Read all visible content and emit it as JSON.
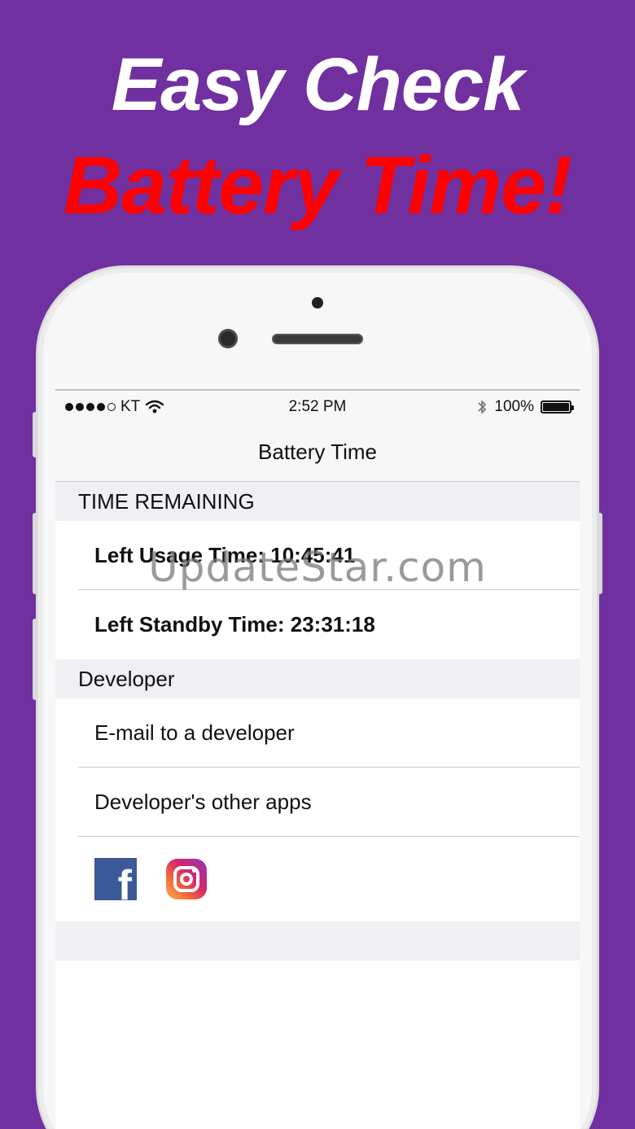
{
  "promo": {
    "line1": "Easy Check",
    "line2": "Battery Time!"
  },
  "colors": {
    "background": "#7030a0",
    "headline1": "#ffffff",
    "headline2": "#ff0000"
  },
  "status_bar": {
    "carrier": "KT",
    "time": "2:52 PM",
    "battery_percent": "100%",
    "battery_level": 1.0
  },
  "nav": {
    "title": "Battery Time"
  },
  "sections": {
    "time_remaining": {
      "header": "TIME REMAINING",
      "usage": "Left Usage Time: 10:45:41",
      "standby": "Left Standby Time: 23:31:18"
    },
    "developer": {
      "header": "Developer",
      "email": "E-mail to a developer",
      "other_apps": "Developer's other apps",
      "facebook_glyph": "f"
    }
  },
  "icons": {
    "wifi": "wifi-icon",
    "bluetooth": "bluetooth-icon",
    "facebook": "facebook-icon",
    "instagram": "instagram-icon"
  },
  "watermark": "UpdateStar.com"
}
